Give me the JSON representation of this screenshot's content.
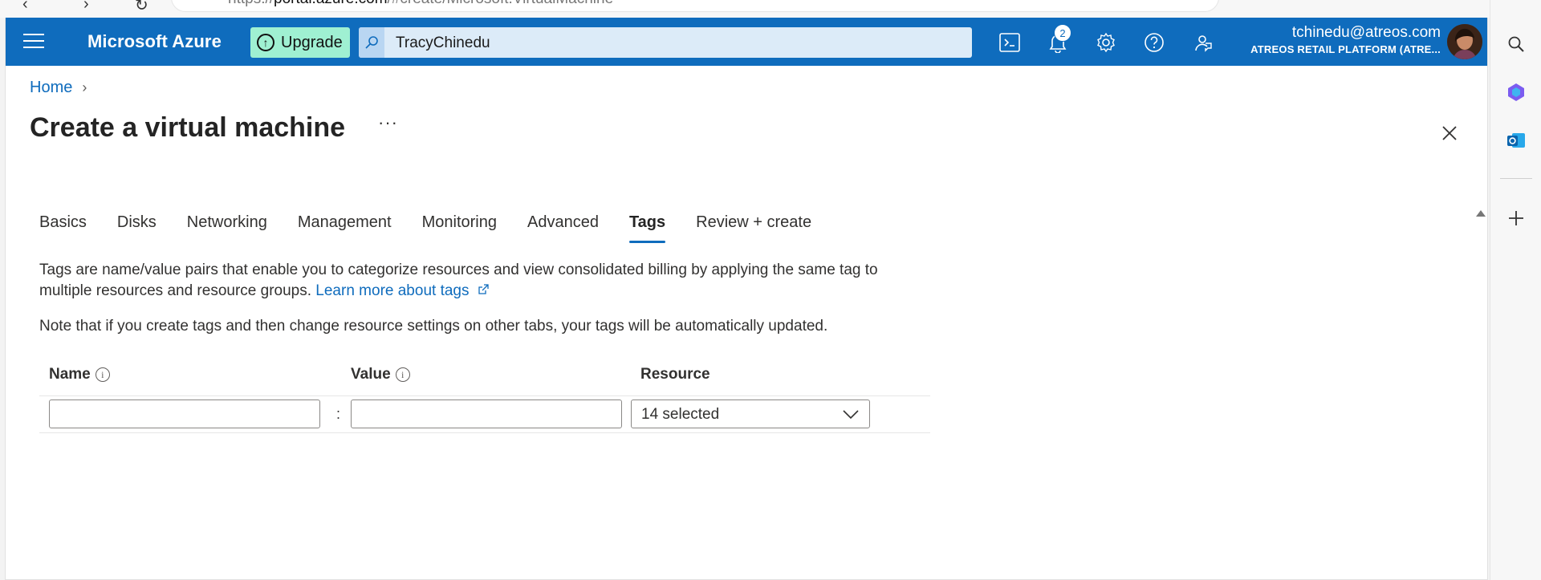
{
  "browser": {
    "url_prefix": "https://",
    "url_host": "portal.azure.com",
    "url_rest": "/#create/Microsoft.VirtualMachine"
  },
  "topbar": {
    "brand": "Microsoft Azure",
    "upgrade_label": "Upgrade",
    "search_value": "TracyChinedu",
    "notifications_count": "2",
    "account_email": "tchinedu@atreos.com",
    "account_tenant": "ATREOS RETAIL PLATFORM (ATRE..."
  },
  "breadcrumb": {
    "home": "Home",
    "separator": "›"
  },
  "page": {
    "title": "Create a virtual machine",
    "more": "···"
  },
  "tabs": [
    {
      "label": "Basics"
    },
    {
      "label": "Disks"
    },
    {
      "label": "Networking"
    },
    {
      "label": "Management"
    },
    {
      "label": "Monitoring"
    },
    {
      "label": "Advanced"
    },
    {
      "label": "Tags",
      "active": true
    },
    {
      "label": "Review + create"
    }
  ],
  "content": {
    "description": "Tags are name/value pairs that enable you to categorize resources and view consolidated billing by applying the same tag to multiple resources and resource groups.",
    "learn_more": "Learn more about tags",
    "note": "Note that if you create tags and then change resource settings on other tabs, your tags will be automatically updated."
  },
  "table": {
    "headers": {
      "name": "Name",
      "value": "Value",
      "resource": "Resource"
    },
    "row": {
      "name": "",
      "value": "",
      "separator": ":",
      "resource": "14 selected"
    }
  },
  "colors": {
    "azure_blue": "#0f6cbd",
    "upgrade_bg": "#9ff0d2",
    "search_bg": "#dcebf8"
  }
}
